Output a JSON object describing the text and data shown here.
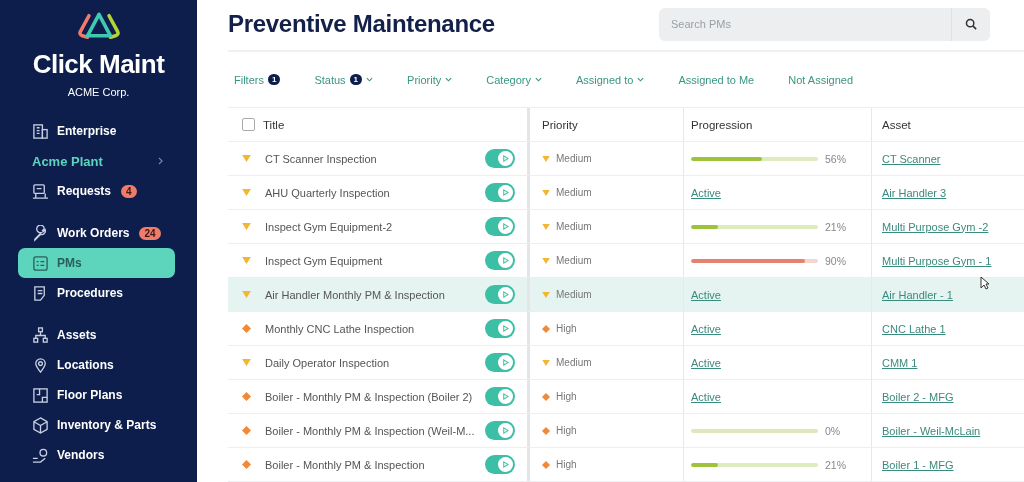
{
  "sidebar": {
    "brand": "Click Maint",
    "company": "ACME Corp.",
    "nav_groups": [
      [
        {
          "label": "Enterprise",
          "kind": "item",
          "selected": false
        },
        {
          "label": "Acme Plant",
          "kind": "section",
          "selected": false
        },
        {
          "label": "Requests",
          "kind": "item",
          "badge": "4",
          "selected": false
        }
      ],
      [
        {
          "label": "Work Orders",
          "kind": "item",
          "badge": "24",
          "selected": false
        },
        {
          "label": "PMs",
          "kind": "item",
          "selected": true
        },
        {
          "label": "Procedures",
          "kind": "item",
          "selected": false
        }
      ],
      [
        {
          "label": "Assets",
          "kind": "item",
          "selected": false
        },
        {
          "label": "Locations",
          "kind": "item",
          "selected": false
        },
        {
          "label": "Floor Plans",
          "kind": "item",
          "selected": false
        },
        {
          "label": "Inventory & Parts",
          "kind": "item",
          "selected": false
        },
        {
          "label": "Vendors",
          "kind": "item",
          "selected": false
        }
      ]
    ]
  },
  "page": {
    "title": "Preventive Maintenance",
    "search": {
      "placeholder": "Search PMs"
    }
  },
  "filters": [
    {
      "label": "Filters",
      "badge": "1",
      "dropdown": false
    },
    {
      "label": "Status",
      "badge": "1",
      "dropdown": true
    },
    {
      "label": "Priority",
      "dropdown": true
    },
    {
      "label": "Category",
      "dropdown": true
    },
    {
      "label": "Assigned to",
      "dropdown": true
    },
    {
      "label": "Assigned to Me",
      "dropdown": false
    },
    {
      "label": "Not Assigned",
      "dropdown": false
    }
  ],
  "table": {
    "select_all_checked": false,
    "columns": [
      "Title",
      "Priority",
      "Progression",
      "Asset"
    ],
    "rows": [
      {
        "title": "CT Scanner Inspection",
        "priority": "Medium",
        "kind": "medium",
        "enabled": true,
        "selected": false,
        "progression": {
          "kind": "progress",
          "level": 0.56,
          "reading": "56%",
          "color": "#9cc33b"
        },
        "asset": "CT Scanner"
      },
      {
        "title": "AHU Quarterly Inspection",
        "priority": "Medium",
        "kind": "medium",
        "enabled": true,
        "selected": false,
        "progression": {
          "kind": "status",
          "text": "Active"
        },
        "asset": "Air Handler 3"
      },
      {
        "title": "Inspect Gym Equipment-2",
        "priority": "Medium",
        "kind": "medium",
        "enabled": true,
        "selected": false,
        "progression": {
          "kind": "progress",
          "level": 0.21,
          "reading": "21%",
          "color": "#9cc33b"
        },
        "asset": "Multi Purpose Gym -2"
      },
      {
        "title": "Inspect Gym Equipment",
        "priority": "Medium",
        "kind": "medium",
        "enabled": true,
        "selected": false,
        "progression": {
          "kind": "progress",
          "level": 0.9,
          "reading": "90%",
          "color": "#e5826f"
        },
        "asset": "Multi Purpose Gym - 1"
      },
      {
        "title": "Air Handler Monthly PM & Inspection",
        "priority": "Medium",
        "kind": "medium",
        "enabled": true,
        "selected": true,
        "progression": {
          "kind": "status",
          "text": "Active"
        },
        "asset": "Air Handler - 1"
      },
      {
        "title": "Monthly CNC Lathe Inspection",
        "priority": "High",
        "kind": "high",
        "enabled": true,
        "selected": false,
        "progression": {
          "kind": "status",
          "text": "Active"
        },
        "asset": "CNC Lathe 1"
      },
      {
        "title": "Daily Operator Inspection",
        "priority": "Medium",
        "kind": "medium",
        "enabled": true,
        "selected": false,
        "progression": {
          "kind": "status",
          "text": "Active"
        },
        "asset": "CMM 1"
      },
      {
        "title": "Boiler - Monthly PM & Inspection (Boiler 2)",
        "priority": "High",
        "kind": "high",
        "enabled": true,
        "selected": false,
        "progression": {
          "kind": "status",
          "text": "Active"
        },
        "asset": "Boiler 2 - MFG"
      },
      {
        "title": "Boiler - Monthly PM & Inspection (Weil-M...",
        "priority": "High",
        "kind": "high",
        "enabled": true,
        "selected": false,
        "progression": {
          "kind": "progress",
          "reading": "0%"
        },
        "asset": "Boiler - Weil-McLain"
      },
      {
        "title": "Boiler - Monthly PM & Inspection",
        "priority": "High",
        "kind": "high",
        "enabled": true,
        "selected": false,
        "progression": {
          "kind": "progress",
          "level": 0.21,
          "reading": "21%",
          "color": "#9cc33b"
        },
        "asset": "Boiler 1 - MFG"
      }
    ]
  }
}
